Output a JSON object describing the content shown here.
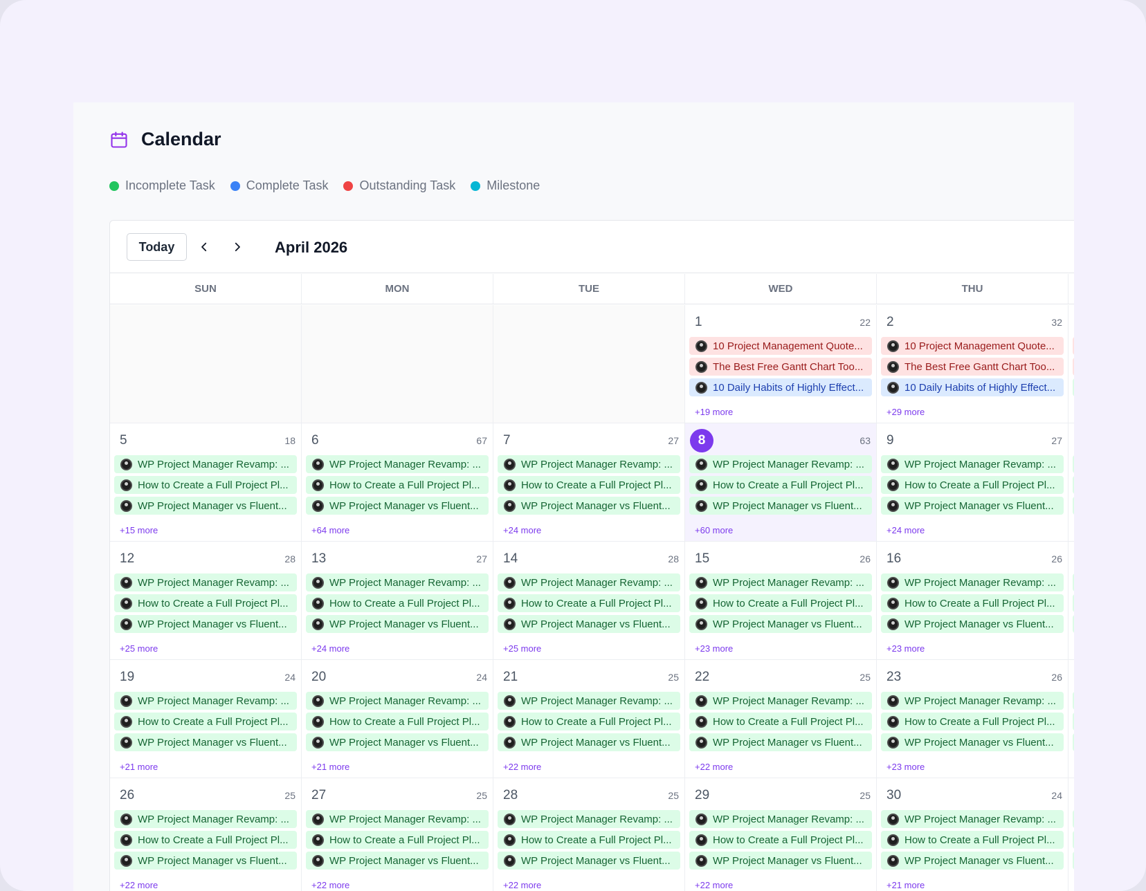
{
  "header": {
    "title": "Calendar",
    "icon": "calendar-icon"
  },
  "legend": [
    {
      "label": "Incomplete Task",
      "color": "#22c55e"
    },
    {
      "label": "Complete Task",
      "color": "#3b82f6"
    },
    {
      "label": "Outstanding Task",
      "color": "#ef4444"
    },
    {
      "label": "Milestone",
      "color": "#06b6d4"
    }
  ],
  "toolbar": {
    "today_label": "Today",
    "prev_icon": "chevron-left-icon",
    "next_icon": "chevron-right-icon",
    "month_label": "April 2026"
  },
  "weekdays": [
    "SUN",
    "MON",
    "TUE",
    "WED",
    "THU"
  ],
  "event_titles": {
    "a": "WP Project Manager Revamp: ...",
    "b": "How to Create a Full Project Pl...",
    "c": "WP Project Manager vs Fluent...",
    "r1": "10 Project Management Quote...",
    "r2": "The Best Free Gantt Chart Too...",
    "b1": "10 Daily Habits of Highly Effect..."
  },
  "weeks": [
    [
      {
        "empty": true
      },
      {
        "empty": true
      },
      {
        "empty": true
      },
      {
        "day": "1",
        "count": "22",
        "more": "+19 more",
        "events": [
          {
            "text": "10 Project Management Quote...",
            "color": "red"
          },
          {
            "text": "The Best Free Gantt Chart Too...",
            "color": "red"
          },
          {
            "text": "10 Daily Habits of Highly Effect...",
            "color": "blue"
          }
        ]
      },
      {
        "day": "2",
        "count": "32",
        "more": "+29 more",
        "events": [
          {
            "text": "10 Project Management Quote...",
            "color": "red"
          },
          {
            "text": "The Best Free Gantt Chart Too...",
            "color": "red"
          },
          {
            "text": "10 Daily Habits of Highly Effect...",
            "color": "blue"
          }
        ]
      }
    ],
    [
      {
        "day": "5",
        "count": "18",
        "more": "+15 more"
      },
      {
        "day": "6",
        "count": "67",
        "more": "+64 more"
      },
      {
        "day": "7",
        "count": "27",
        "more": "+24 more"
      },
      {
        "day": "8",
        "count": "63",
        "more": "+60 more",
        "today": true
      },
      {
        "day": "9",
        "count": "27",
        "more": "+24 more"
      }
    ],
    [
      {
        "day": "12",
        "count": "28",
        "more": "+25 more"
      },
      {
        "day": "13",
        "count": "27",
        "more": "+24 more"
      },
      {
        "day": "14",
        "count": "28",
        "more": "+25 more"
      },
      {
        "day": "15",
        "count": "26",
        "more": "+23 more"
      },
      {
        "day": "16",
        "count": "26",
        "more": "+23 more"
      }
    ],
    [
      {
        "day": "19",
        "count": "24",
        "more": "+21 more"
      },
      {
        "day": "20",
        "count": "24",
        "more": "+21 more"
      },
      {
        "day": "21",
        "count": "25",
        "more": "+22 more"
      },
      {
        "day": "22",
        "count": "25",
        "more": "+22 more"
      },
      {
        "day": "23",
        "count": "26",
        "more": "+23 more"
      }
    ],
    [
      {
        "day": "26",
        "count": "25",
        "more": "+22 more"
      },
      {
        "day": "27",
        "count": "25",
        "more": "+22 more"
      },
      {
        "day": "28",
        "count": "25",
        "more": "+22 more"
      },
      {
        "day": "29",
        "count": "25",
        "more": "+22 more"
      },
      {
        "day": "30",
        "count": "24",
        "more": "+21 more"
      }
    ]
  ],
  "colors": {
    "accent": "#7c3aed",
    "green_bg": "#dcfce7",
    "red_bg": "#fee2e2",
    "blue_bg": "#dbeafe"
  }
}
